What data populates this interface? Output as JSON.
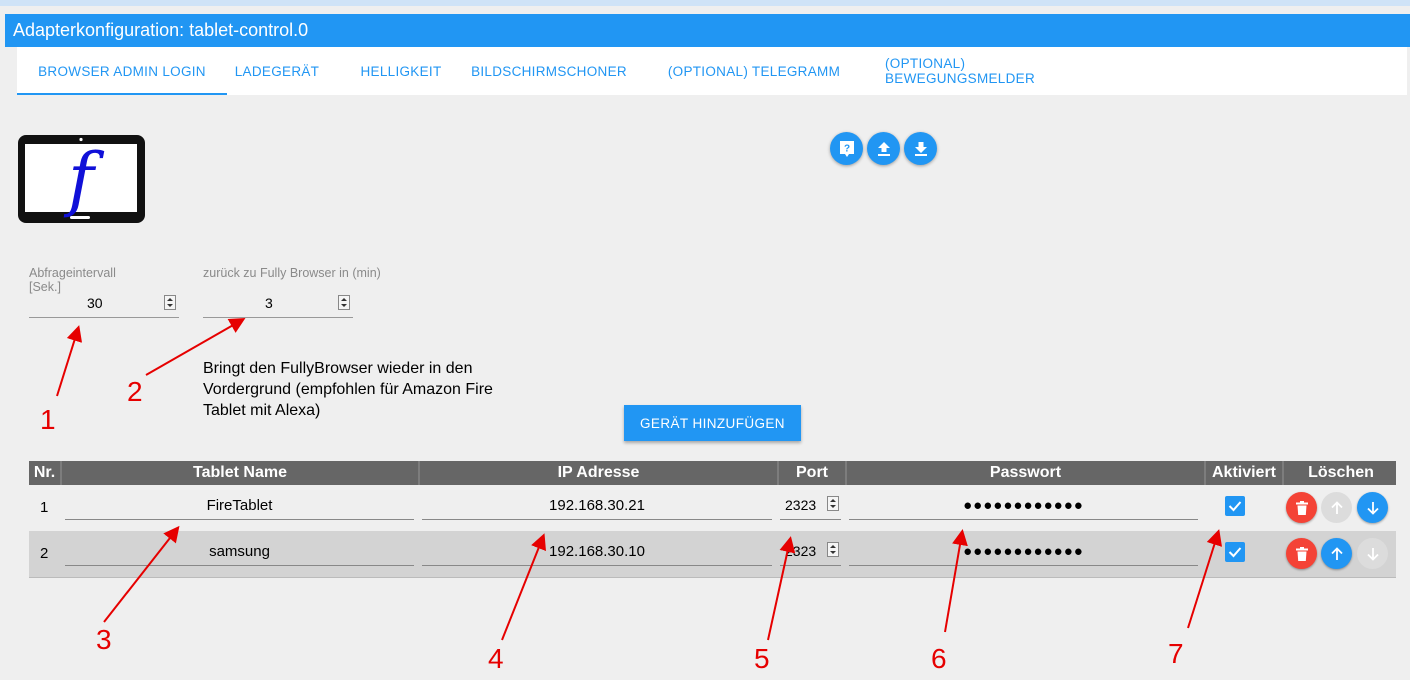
{
  "window": {
    "title": "Adapterkonfiguration: tablet-control.0"
  },
  "tabs": [
    {
      "label": "BROWSER ADMIN LOGIN",
      "active": true
    },
    {
      "label": "LADEGERÄT",
      "active": false
    },
    {
      "label": "HELLIGKEIT",
      "active": false
    },
    {
      "label": "BILDSCHIRMSCHONER",
      "active": false
    },
    {
      "label": "(OPTIONAL) TELEGRAMM",
      "active": false
    },
    {
      "label": "(OPTIONAL) BEWEGUNGSMELDER",
      "active": false
    }
  ],
  "logo": {
    "letter": "f",
    "icon": "tablet-icon"
  },
  "toolbar": {
    "icons": [
      "help-icon",
      "upload-icon",
      "download-icon"
    ]
  },
  "settings": {
    "interval": {
      "label_line1": "Abfrageintervall",
      "label_line2": "[Sek.]",
      "value": "30"
    },
    "back_to_fully": {
      "label": "zurück zu Fully Browser in (min)",
      "value": "3"
    },
    "note": "Bringt den FullyBrowser wieder in den Vordergrund (empfohlen für Amazon Fire Tablet mit Alexa)"
  },
  "add_button": {
    "label": "GERÄT HINZUFÜGEN"
  },
  "table": {
    "columns": [
      "Nr.",
      "Tablet Name",
      "IP Adresse",
      "Port",
      "Passwort",
      "Aktiviert",
      "Löschen"
    ],
    "rows": [
      {
        "nr": "1",
        "name": "FireTablet",
        "ip": "192.168.30.21",
        "port": "2323",
        "password": "●●●●●●●●●●●●",
        "active": true,
        "up_enabled": false,
        "down_enabled": true
      },
      {
        "nr": "2",
        "name": "samsung",
        "ip": "192.168.30.10",
        "port": "2323",
        "password": "●●●●●●●●●●●●",
        "active": true,
        "up_enabled": true,
        "down_enabled": false
      }
    ]
  },
  "annotations": [
    "1",
    "2",
    "3",
    "4",
    "5",
    "6",
    "7"
  ],
  "colors": {
    "accent": "#2196f3",
    "delete": "#f44336",
    "annotation": "#e60000",
    "header": "#666666"
  }
}
